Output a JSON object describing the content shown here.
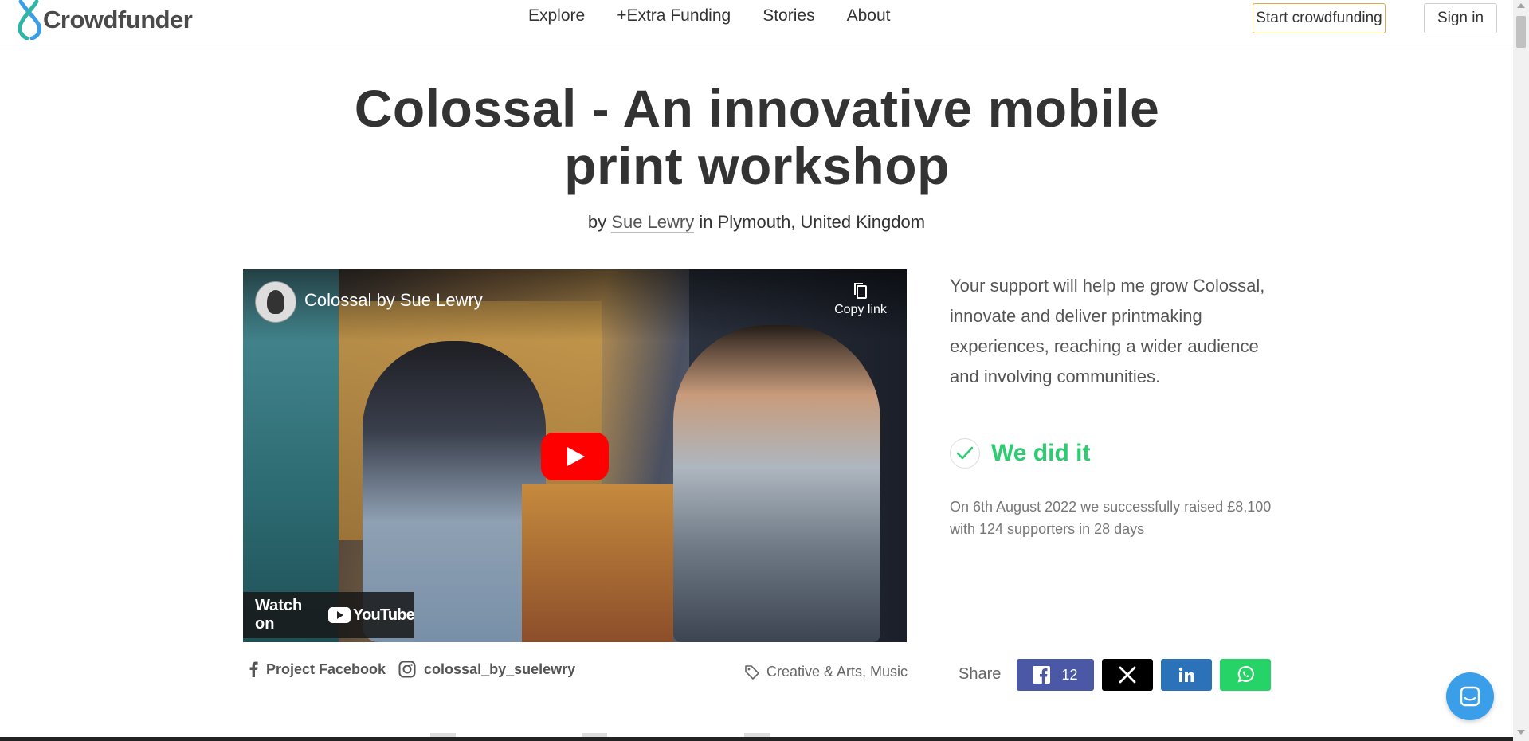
{
  "header": {
    "logo_text": "Crowdfunder",
    "nav": [
      "Explore",
      "+Extra Funding",
      "Stories",
      "About"
    ],
    "start_button": "Start crowdfunding",
    "signin_button": "Sign in"
  },
  "project": {
    "title": "Colossal - An innovative mobile print workshop",
    "by_prefix": "by",
    "author": "Sue Lewry",
    "in_word": "in",
    "location": "Plymouth, United Kingdom"
  },
  "video": {
    "channel_title": "Colossal by Sue Lewry",
    "copy_link_label": "Copy link",
    "watch_on_label": "Watch on",
    "youtube_label": "YouTube"
  },
  "pitch": "Your support will help me grow Colossal, innovate and deliver printmaking experiences, reaching a wider audience and involving communities.",
  "status": {
    "label": "We did it",
    "summary": "On 6th August 2022 we successfully raised £8,100 with 124 supporters in 28 days",
    "color": "#2ecc71"
  },
  "links": {
    "facebook": "Project Facebook",
    "instagram": "colossal_by_suelewry"
  },
  "tags": "Creative & Arts, Music",
  "share": {
    "label": "Share",
    "facebook_count": "12",
    "colors": {
      "facebook": "#4a58a6",
      "x": "#000000",
      "linkedin": "#2c72b9",
      "whatsapp": "#25d366"
    }
  },
  "colors": {
    "accent_border": "#e0a84a",
    "success": "#2ecc71",
    "chat": "#3b9ee8"
  }
}
